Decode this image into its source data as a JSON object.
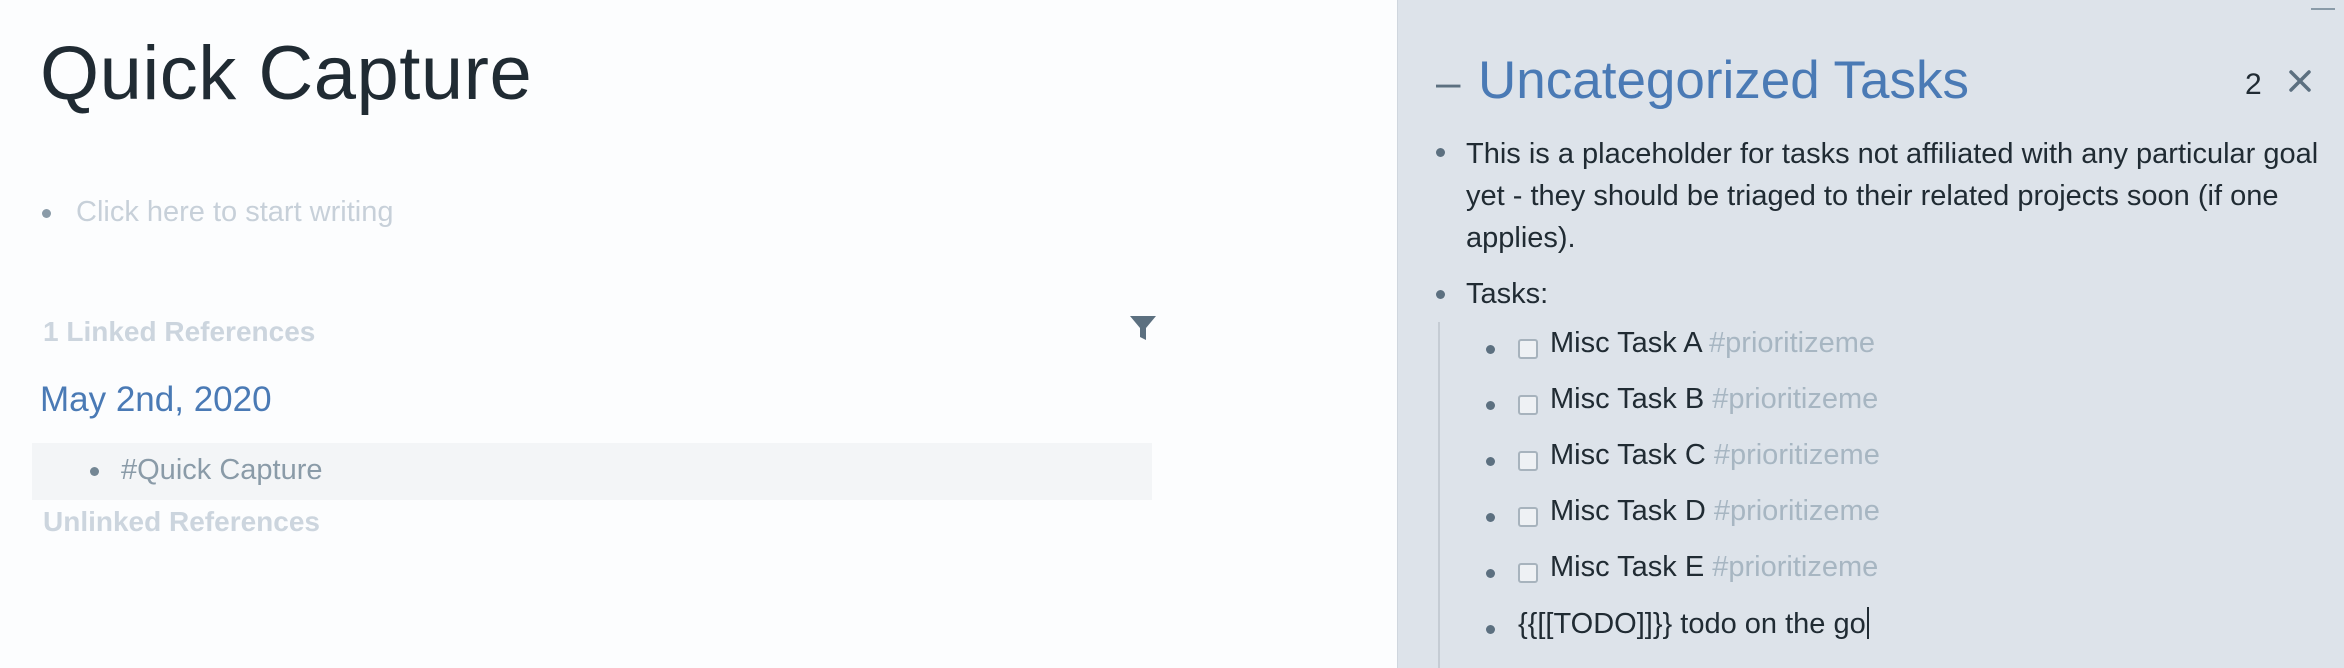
{
  "main": {
    "title": "Quick Capture",
    "placeholder": "Click here to start writing",
    "linked_references_heading": "1 Linked References",
    "linked_refs": [
      {
        "page_title": "May 2nd, 2020",
        "block_text": "#Quick Capture"
      }
    ],
    "unlinked_references_heading": "Unlinked References"
  },
  "sidebar": {
    "collapse_symbol": "–",
    "title": "Uncategorized Tasks",
    "count": "2",
    "description": "This is a placeholder for tasks not affiliated with any particular goal yet - they should be triaged to their related projects soon (if one applies).",
    "tasks_label": "Tasks:",
    "tasks": [
      {
        "name": "Misc Task A",
        "tag": "#prioritizeme"
      },
      {
        "name": "Misc Task B",
        "tag": "#prioritizeme"
      },
      {
        "name": "Misc Task C",
        "tag": "#prioritizeme"
      },
      {
        "name": "Misc Task D",
        "tag": "#prioritizeme"
      },
      {
        "name": "Misc Task E",
        "tag": "#prioritizeme"
      }
    ],
    "editing_block": "{{[[TODO]]}} todo on the go"
  },
  "icons": {
    "filter": "filter-icon",
    "close": "close-icon",
    "checkbox": "checkbox-icon"
  },
  "colors": {
    "link_blue": "#4a7ab5",
    "sidebar_bg": "#dde3ea",
    "muted_text": "#ccd5de",
    "tag_gray": "#a7b6c2"
  }
}
